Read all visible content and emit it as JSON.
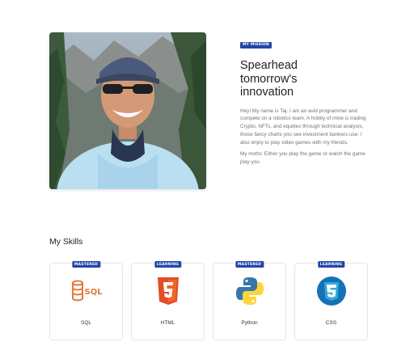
{
  "about": {
    "badge": "MY MISSION",
    "headline": "Spearhead tomorrow's innovation",
    "paragraph1": "Hey! My name is Taj. I am an avid programmer and compete on a robotics team. A hobby of mine is trading Crypto, NFTs, and equities through technical analysis, those fancy charts you see investment bankers use. I also enjoy to play video games with my friends.",
    "paragraph2": "My motto: Either you play the game or watch the game play you"
  },
  "skills": {
    "title": "My Skills",
    "items": [
      {
        "name": "SQL",
        "status": "MASTERED",
        "icon": "sql-icon",
        "color": "#e07b39"
      },
      {
        "name": "HTML",
        "status": "LEARNING",
        "icon": "html5-icon",
        "color": "#e44d26"
      },
      {
        "name": "Python",
        "status": "MASTERED",
        "icon": "python-icon",
        "color": "#3776ab"
      },
      {
        "name": "CSS",
        "status": "LEARNING",
        "icon": "css3-icon",
        "color": "#1572b6"
      }
    ]
  },
  "colors": {
    "badge": "#2345a8",
    "muted_text": "#6c757d"
  }
}
